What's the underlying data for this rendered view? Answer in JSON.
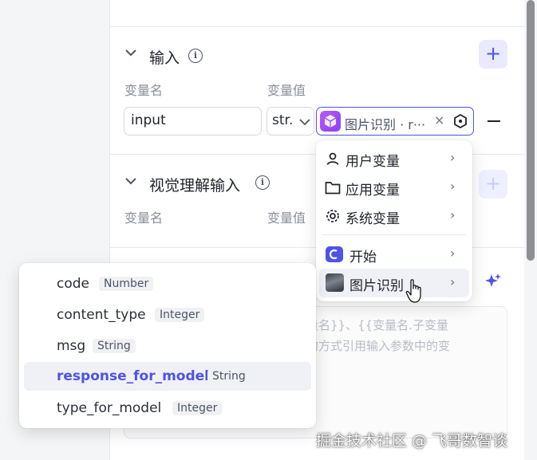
{
  "input_section": {
    "title": "输入",
    "col_name_label": "变量名",
    "col_value_label": "变量值",
    "row": {
      "name_value": "input",
      "type_value": "str.",
      "ref_tag": "图片识别 · r···",
      "ref_tag_close": "×"
    }
  },
  "visual_section": {
    "title": "视觉理解输入",
    "col_name_label": "变量名",
    "col_value_label": "变量值"
  },
  "variable_menu": {
    "items": [
      {
        "label": "用户变量",
        "icon": "user-icon"
      },
      {
        "label": "应用变量",
        "icon": "folder-icon"
      },
      {
        "label": "系统变量",
        "icon": "gear-icon"
      },
      {
        "label": "开始",
        "icon": "start-node-icon"
      },
      {
        "label": "图片识别",
        "icon": "image-node-thumbnail"
      }
    ],
    "arrow": "›"
  },
  "output_submenu": {
    "items": [
      {
        "name": "code",
        "type": "Number"
      },
      {
        "name": "content_type",
        "type": "Integer"
      },
      {
        "name": "msg",
        "type": "String"
      },
      {
        "name": "response_for_model",
        "type": "String",
        "highlighted": true
      },
      {
        "name": "type_for_model",
        "type": "Integer"
      }
    ]
  },
  "prompt_placeholder": {
    "line1": "量名}}、{{变量名.子变量",
    "line2": "的方式引用输入参数中的变"
  },
  "icons": {
    "add": "+",
    "minus": "−",
    "chevron": "∨",
    "info": "i",
    "sparkle": "sparkle-icon"
  },
  "colors": {
    "accent": "#4d53e8",
    "accent_bg": "#e9e9ff",
    "highlight_bg": "#f0f1f6"
  },
  "watermark": "掘金技术社区 @ 飞哥数智谈"
}
